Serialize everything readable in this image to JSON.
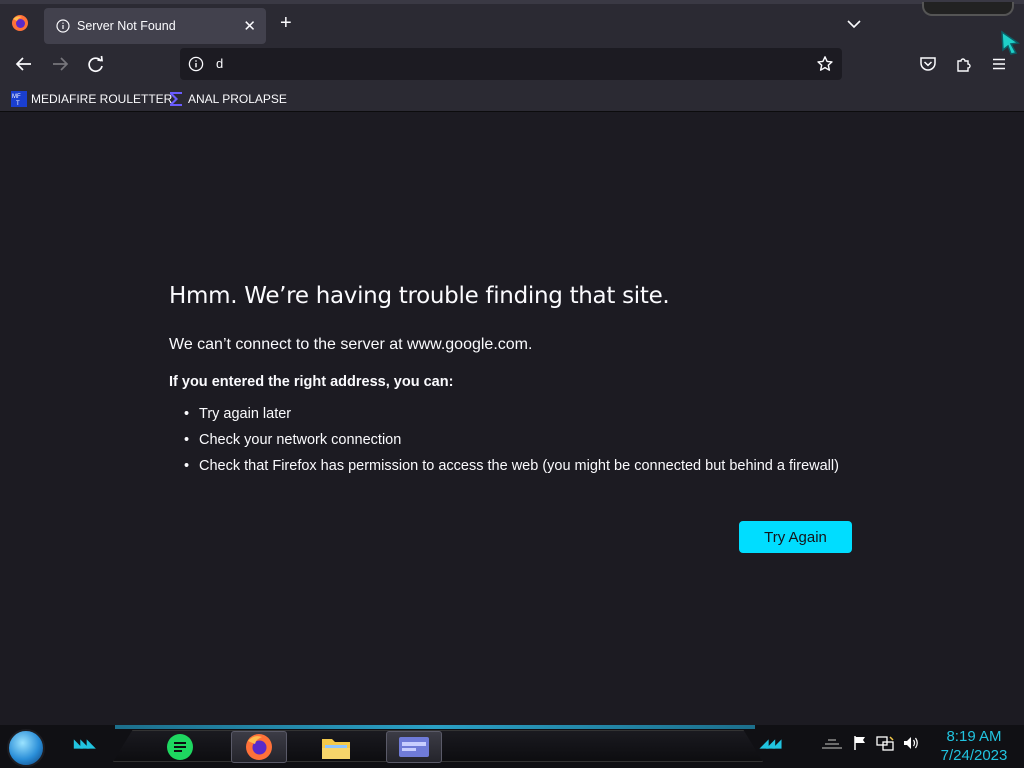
{
  "browser": {
    "tab": {
      "title": "Server Not Found",
      "close_glyph": "✕"
    },
    "new_tab_glyph": "+",
    "urlbar": {
      "value": "d"
    },
    "bookmarks": [
      {
        "label": "MEDIAFIRE ROULETTER",
        "icon": "mediafire-favicon"
      },
      {
        "label": "ANAL PROLAPSE",
        "icon": "sigma-favicon"
      }
    ]
  },
  "error_page": {
    "title": "Hmm. We’re having trouble finding that site.",
    "message": "We can’t connect to the server at www.google.com.",
    "suggestions_heading": "If you entered the right address, you can:",
    "suggestions": [
      "Try again later",
      "Check your network connection",
      "Check that Firefox has permission to access the web (you might be connected but behind a firewall)"
    ],
    "try_again_label": "Try Again"
  },
  "taskbar": {
    "apps": [
      "notes-app",
      "firefox",
      "file-explorer",
      "window-app"
    ],
    "clock": {
      "time": "8:19 AM",
      "date": "7/24/2023"
    }
  },
  "colors": {
    "accent": "#00ddff",
    "background": "#1c1b22",
    "toolbar": "#2b2a33",
    "clock": "#21c4e0"
  }
}
